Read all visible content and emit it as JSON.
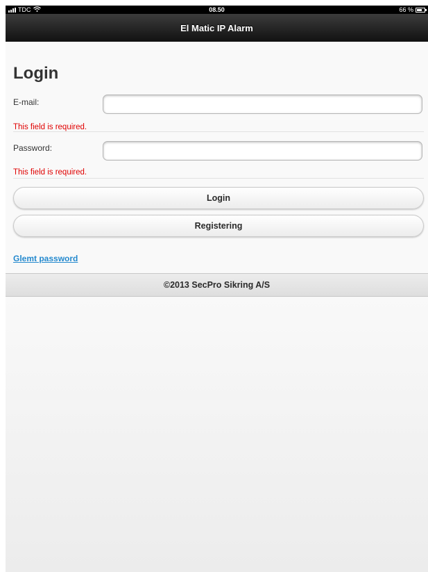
{
  "status_bar": {
    "carrier": "TDC",
    "time": "08.50",
    "battery": "66 %",
    "icons": [
      "signal-icon",
      "wifi-icon",
      "battery-icon"
    ]
  },
  "header": {
    "title": "El Matic IP Alarm"
  },
  "login_form": {
    "title": "Login",
    "email": {
      "label": "E-mail:",
      "value": "",
      "error": "This field is required."
    },
    "password": {
      "label": "Password:",
      "value": "",
      "error": "This field is required."
    },
    "login_button": "Login",
    "register_button": "Registering",
    "forgot_link": "Glemt password"
  },
  "footer": {
    "copyright": "©2013 SecPro Sikring A/S"
  },
  "colors": {
    "error": "#e00000",
    "link": "#2489ce",
    "header_bg": "#1a1a1a"
  }
}
